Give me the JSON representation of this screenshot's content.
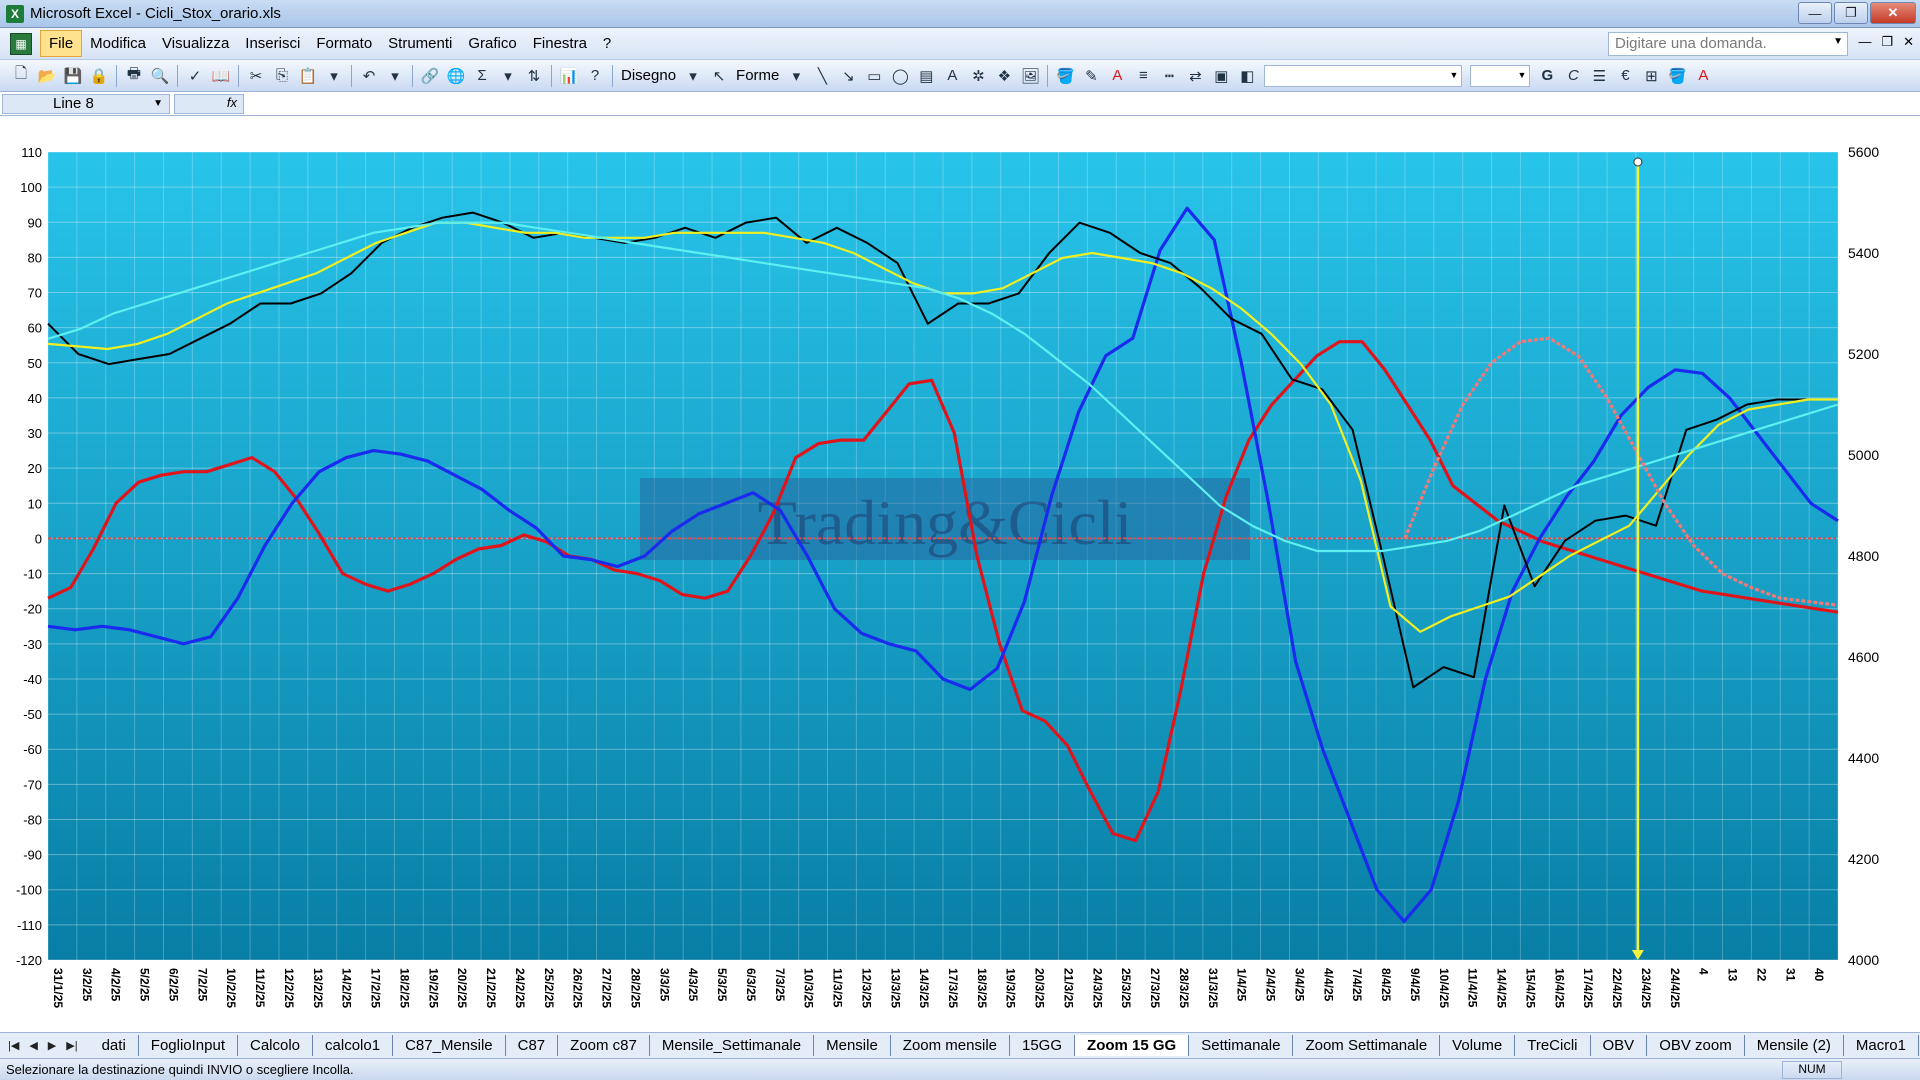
{
  "window": {
    "title": "Microsoft Excel - Cicli_Stox_orario.xls"
  },
  "menu": {
    "items": [
      "File",
      "Modifica",
      "Visualizza",
      "Inserisci",
      "Formato",
      "Strumenti",
      "Grafico",
      "Finestra",
      "?"
    ]
  },
  "ask_box": {
    "placeholder": "Digitare una domanda."
  },
  "toolbar": {
    "drawing_label": "Disegno",
    "shapes_label": "Forme"
  },
  "formula_bar": {
    "name_box": "Line 8",
    "fx": "fx"
  },
  "sheet_tabs": [
    "dati",
    "FoglioInput",
    "Calcolo",
    "calcolo1",
    "C87_Mensile",
    "C87",
    "Zoom c87",
    "Mensile_Settimanale",
    "Mensile",
    "Zoom mensile",
    "15GG",
    "Zoom 15 GG",
    "Settimanale",
    "Zoom Settimanale",
    "Volume",
    "TreCicli",
    "OBV",
    "OBV zoom",
    "Mensile (2)",
    "Macro1"
  ],
  "active_sheet": "Zoom 15 GG",
  "status": {
    "message": "Selezionare la destinazione quindi INVIO o scegliere Incolla.",
    "num": "NUM"
  },
  "colors": {
    "plot_top": "#28c4ea",
    "plot_bottom": "#087ea5",
    "cycle_red": "#e0141b",
    "cycle_blue": "#1a2aef",
    "price": "#000000",
    "ma_fast": "#f2ef20",
    "ma_slow": "#5ef0f0",
    "projection": "#f07a78",
    "zero_line": "#e44a4a",
    "marker": "#f5f23a"
  },
  "chart_data": {
    "type": "line",
    "watermark": "Trading&Cicli",
    "y_left": {
      "min": -120,
      "max": 110,
      "step": 10
    },
    "y_right": {
      "min": 4000,
      "max": 5600,
      "step": 200
    },
    "x_labels": [
      "31/1/25",
      "3/2/25",
      "4/2/25",
      "5/2/25",
      "6/2/25",
      "7/2/25",
      "10/2/25",
      "11/2/25",
      "12/2/25",
      "13/2/25",
      "14/2/25",
      "17/2/25",
      "18/2/25",
      "19/2/25",
      "20/2/25",
      "21/2/25",
      "24/2/25",
      "25/2/25",
      "26/2/25",
      "27/2/25",
      "28/2/25",
      "3/3/25",
      "4/3/25",
      "5/3/25",
      "6/3/25",
      "7/3/25",
      "10/3/25",
      "11/3/25",
      "12/3/25",
      "13/3/25",
      "14/3/25",
      "17/3/25",
      "18/3/25",
      "19/3/25",
      "20/3/25",
      "21/3/25",
      "24/3/25",
      "25/3/25",
      "27/3/25",
      "28/3/25",
      "31/3/25",
      "1/4/25",
      "2/4/25",
      "3/4/25",
      "4/4/25",
      "7/4/25",
      "8/4/25",
      "9/4/25",
      "10/4/25",
      "11/4/25",
      "14/4/25",
      "15/4/25",
      "16/4/25",
      "17/4/25",
      "22/4/25",
      "23/4/25",
      "24/4/25",
      "4",
      "13",
      "22",
      "31",
      "40"
    ],
    "marker_label": "23/4/25",
    "series": [
      {
        "axis": "left",
        "color_key": "cycle_red",
        "values": [
          -17,
          -14,
          -3,
          10,
          16,
          18,
          19,
          19,
          21,
          23,
          19,
          11,
          1,
          -10,
          -13,
          -15,
          -13,
          -10,
          -6,
          -3,
          -2,
          1,
          -1,
          -5,
          -6,
          -9,
          -10,
          -12,
          -16,
          -17,
          -15,
          -5,
          7,
          23,
          27,
          28,
          28,
          36,
          44,
          45,
          30,
          -5,
          -30,
          -49,
          -52,
          -59,
          -72,
          -84,
          -86,
          -72,
          -43,
          -10,
          12,
          28,
          38,
          45,
          52,
          56,
          56,
          48,
          38,
          28,
          15,
          10,
          5,
          2,
          -1,
          -3,
          -5,
          -7,
          -9,
          -11,
          -13,
          -15,
          -16,
          -17,
          -18,
          -19,
          -20,
          -21
        ]
      },
      {
        "axis": "left",
        "color_key": "cycle_blue",
        "values": [
          -25,
          -26,
          -25,
          -26,
          -28,
          -30,
          -28,
          -17,
          -2,
          10,
          19,
          23,
          25,
          24,
          22,
          18,
          14,
          8,
          3,
          -5,
          -6,
          -8,
          -5,
          2,
          7,
          10,
          13,
          8,
          -5,
          -20,
          -27,
          -30,
          -32,
          -40,
          -43,
          -37,
          -18,
          12,
          36,
          52,
          57,
          82,
          94,
          85,
          50,
          10,
          -35,
          -60,
          -80,
          -100,
          -109,
          -100,
          -75,
          -40,
          -15,
          0,
          12,
          22,
          35,
          43,
          48,
          47,
          40,
          30,
          20,
          10,
          5
        ]
      },
      {
        "axis": "right",
        "color_key": "price",
        "values": [
          5260,
          5200,
          5180,
          5190,
          5200,
          5230,
          5260,
          5300,
          5300,
          5320,
          5360,
          5420,
          5450,
          5470,
          5480,
          5460,
          5430,
          5440,
          5430,
          5420,
          5430,
          5450,
          5430,
          5460,
          5470,
          5420,
          5450,
          5420,
          5380,
          5260,
          5300,
          5300,
          5320,
          5400,
          5460,
          5440,
          5400,
          5380,
          5330,
          5270,
          5240,
          5150,
          5130,
          5050,
          4800,
          4540,
          4580,
          4560,
          4900,
          4740,
          4830,
          4870,
          4880,
          4860,
          5050,
          5070,
          5100,
          5110,
          5110,
          5110
        ]
      },
      {
        "axis": "right",
        "color_key": "ma_fast",
        "values": [
          5220,
          5215,
          5210,
          5220,
          5240,
          5270,
          5300,
          5320,
          5340,
          5360,
          5390,
          5420,
          5440,
          5460,
          5460,
          5450,
          5440,
          5440,
          5430,
          5430,
          5430,
          5440,
          5440,
          5440,
          5440,
          5430,
          5420,
          5400,
          5370,
          5340,
          5320,
          5320,
          5330,
          5360,
          5390,
          5400,
          5390,
          5380,
          5360,
          5330,
          5290,
          5240,
          5180,
          5100,
          4950,
          4700,
          4650,
          4680,
          4700,
          4720,
          4760,
          4800,
          4830,
          4860,
          4930,
          5000,
          5060,
          5090,
          5100,
          5110,
          5110
        ]
      },
      {
        "axis": "right",
        "color_key": "ma_slow",
        "values": [
          5230,
          5250,
          5280,
          5300,
          5320,
          5340,
          5360,
          5380,
          5400,
          5420,
          5440,
          5450,
          5460,
          5460,
          5460,
          5450,
          5440,
          5430,
          5420,
          5410,
          5400,
          5390,
          5380,
          5370,
          5360,
          5350,
          5340,
          5330,
          5310,
          5280,
          5240,
          5190,
          5140,
          5080,
          5020,
          4960,
          4900,
          4860,
          4830,
          4810,
          4810,
          4810,
          4820,
          4830,
          4850,
          4880,
          4910,
          4940,
          4960,
          4980,
          5000,
          5020,
          5040,
          5060,
          5080,
          5100
        ]
      },
      {
        "axis": "left",
        "color_key": "projection",
        "values": [
          0,
          20,
          38,
          50,
          56,
          57,
          52,
          40,
          25,
          10,
          -2,
          -10,
          -14,
          -17,
          -18,
          -19
        ]
      }
    ]
  }
}
